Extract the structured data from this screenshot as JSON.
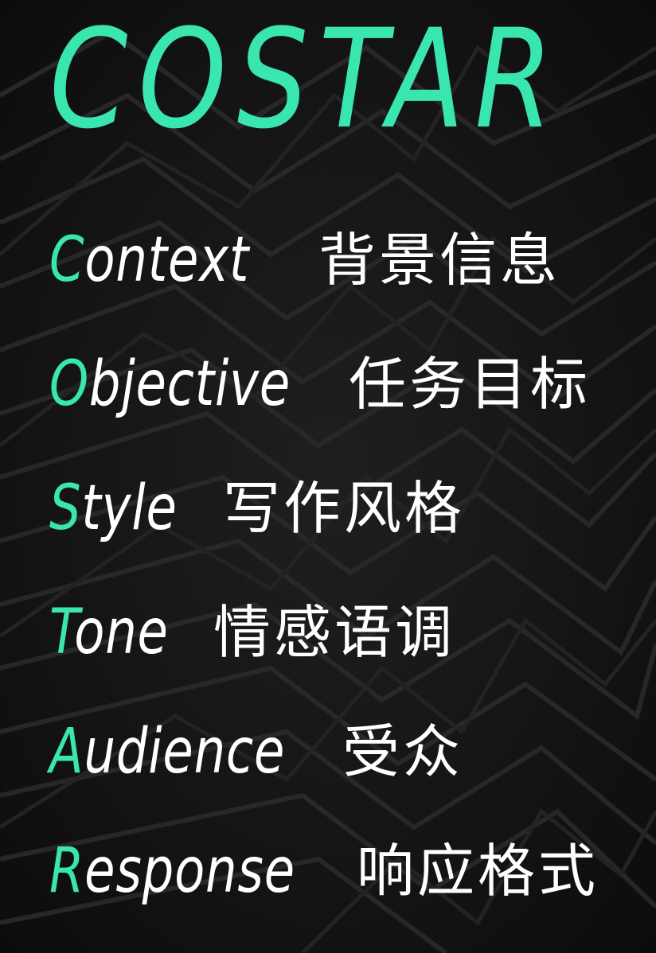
{
  "title": "COSTAR",
  "items": [
    {
      "initial": "C",
      "rest": "ontext",
      "zh": "背景信息"
    },
    {
      "initial": "O",
      "rest": "bjective",
      "zh": "任务目标"
    },
    {
      "initial": "S",
      "rest": "tyle",
      "zh": "写作风格"
    },
    {
      "initial": "T",
      "rest": "one",
      "zh": "情感语调"
    },
    {
      "initial": "A",
      "rest": "udience",
      "zh": "受众"
    },
    {
      "initial": "R",
      "rest": "esponse",
      "zh": "响应格式"
    }
  ],
  "colors": {
    "accent": "#3ae6b0",
    "text": "#ffffff",
    "background": "#141414"
  }
}
